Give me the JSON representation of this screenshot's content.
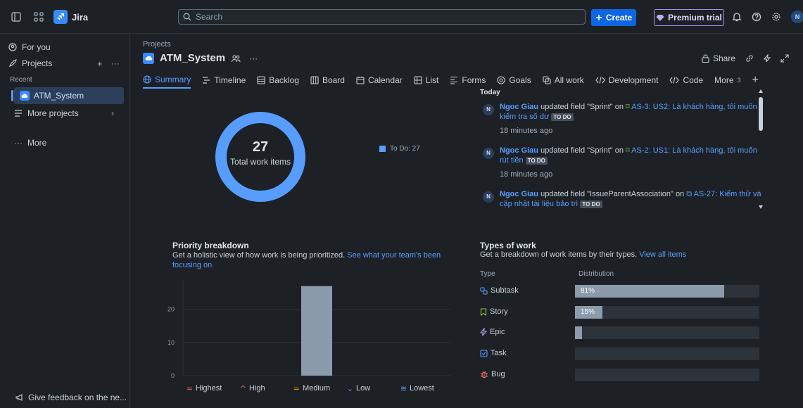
{
  "topbar": {
    "app_name": "Jira",
    "search_placeholder": "Search",
    "create_label": "Create",
    "premium_label": "Premium trial",
    "avatar_initial": "N"
  },
  "sidebar": {
    "for_you": "For you",
    "projects": "Projects",
    "recent": "Recent",
    "current_project": "ATM_System",
    "more_projects": "More projects",
    "more": "More",
    "feedback": "Give feedback on the ne..."
  },
  "header": {
    "breadcrumb": "Projects",
    "project_title": "ATM_System",
    "share_label": "Share"
  },
  "tabs": [
    {
      "label": "Summary",
      "icon": "globe-icon"
    },
    {
      "label": "Timeline",
      "icon": "timeline-icon"
    },
    {
      "label": "Backlog",
      "icon": "backlog-icon"
    },
    {
      "label": "Board",
      "icon": "board-icon"
    },
    {
      "label": "Calendar",
      "icon": "calendar-icon"
    },
    {
      "label": "List",
      "icon": "list-icon"
    },
    {
      "label": "Forms",
      "icon": "forms-icon"
    },
    {
      "label": "Goals",
      "icon": "goals-icon"
    },
    {
      "label": "All work",
      "icon": "allwork-icon"
    },
    {
      "label": "Development",
      "icon": "code-icon"
    },
    {
      "label": "Code",
      "icon": "code-icon"
    },
    {
      "label": "More",
      "icon": ""
    }
  ],
  "more_count": "3",
  "status_overview": {
    "total": "27",
    "total_label": "Total work items",
    "legend": "To Do: 27",
    "color": "#579dff"
  },
  "activity": {
    "heading": "Today",
    "items": [
      {
        "user": "Ngoc Giau",
        "action": " updated field \"Sprint\" on ",
        "link": "AS-3: US2: Là khách hàng, tôi muốn kiểm tra số dư",
        "status": "TO DO",
        "time": "18 minutes ago"
      },
      {
        "user": "Ngoc Giau",
        "action": " updated field \"Sprint\" on ",
        "link": "AS-2: US1: Là khách hàng, tôi muốn rút tiền",
        "status": "TO DO",
        "time": "18 minutes ago"
      },
      {
        "user": "Ngoc Giau",
        "action": " updated field \"IssueParentAssociation\" on ",
        "link": "AS-27: Kiểm thử và cập nhật tài liệu bảo trì",
        "status": "TO DO",
        "time": ""
      }
    ]
  },
  "priority": {
    "title": "Priority breakdown",
    "desc": "Get a holistic view of how work is being prioritized. ",
    "link": "See what your team's been focusing on"
  },
  "chart_data": {
    "type": "bar",
    "categories": [
      "Highest",
      "High",
      "Medium",
      "Low",
      "Lowest"
    ],
    "values": [
      0,
      0,
      27,
      0,
      0
    ],
    "yticks": [
      "0",
      "10",
      "20"
    ],
    "ylim": [
      0,
      28
    ],
    "colors": {
      "Highest": "#f87168",
      "High": "#f87168",
      "Medium": "#fca700",
      "Low": "#579dff",
      "Lowest": "#579dff"
    },
    "bar_color": "#8c9bab"
  },
  "types": {
    "title": "Types of work",
    "desc": "Get a breakdown of work items by their types. ",
    "link": "View all items",
    "col_type": "Type",
    "col_dist": "Distribution",
    "rows": [
      {
        "label": "Subtask",
        "pct": 81,
        "pct_label": "81%",
        "icon": "subtask-icon"
      },
      {
        "label": "Story",
        "pct": 15,
        "pct_label": "15%",
        "icon": "story-icon"
      },
      {
        "label": "Epic",
        "pct": 4,
        "pct_label": "",
        "icon": "epic-icon"
      },
      {
        "label": "Task",
        "pct": 0,
        "pct_label": "",
        "icon": "task-icon"
      },
      {
        "label": "Bug",
        "pct": 0,
        "pct_label": "",
        "icon": "bug-icon"
      }
    ]
  }
}
